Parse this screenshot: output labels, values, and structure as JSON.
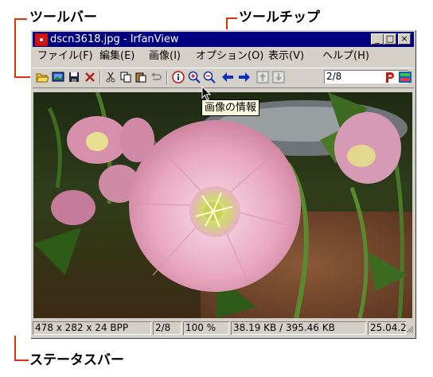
{
  "callouts": {
    "toolbar": "ツールバー",
    "tooltip": "ツールチップ",
    "statusbar": "ステータスバー"
  },
  "window": {
    "title": "dscn3618.jpg - IrfanView",
    "minimize_label": "_",
    "maximize_label": "□",
    "close_label": "×"
  },
  "menu": [
    {
      "label": "ファイル(F)"
    },
    {
      "label": "編集(E)"
    },
    {
      "label": "画像(I)"
    },
    {
      "label": "オプション(O)"
    },
    {
      "label": "表示(V)"
    },
    {
      "label": "ヘルプ(H)"
    }
  ],
  "toolbar": {
    "icons": [
      "open-folder-icon",
      "slideshow-icon",
      "save-icon",
      "delete-icon",
      "cut-icon",
      "copy-icon",
      "paste-icon",
      "undo-icon",
      "info-icon",
      "zoom-in-icon",
      "zoom-out-icon",
      "previous-arrow-icon",
      "next-arrow-icon",
      "first-file-icon",
      "last-file-icon",
      "print-icon",
      "thumbnails-icon"
    ],
    "page_value": "2/8"
  },
  "tooltip": {
    "text": "画像の情報"
  },
  "status": {
    "dimensions": "478 x 282 x 24 BPP",
    "page": "2/8",
    "zoom": "100 %",
    "filesize": "38.19 KB / 395.46 KB",
    "date": "25.04.2"
  },
  "colors": {
    "title_bar": "#000080",
    "callout_line": "#e03010",
    "tooltip_bg": "#ffffe1"
  }
}
